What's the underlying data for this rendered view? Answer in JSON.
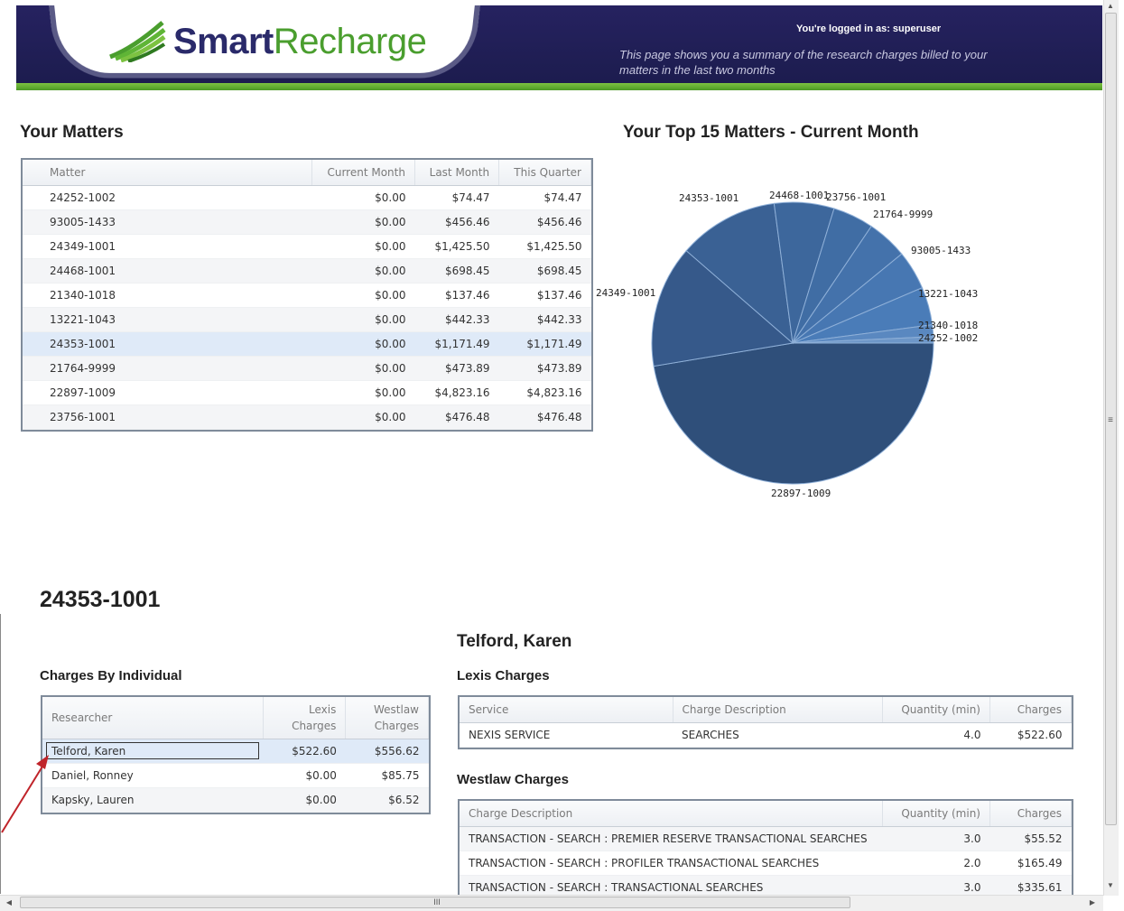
{
  "header": {
    "logo_smart": "Smart",
    "logo_recharge": "Recharge",
    "logged_in": "You're logged in as: superuser",
    "description": "This page shows you a summary of the research charges billed to your matters in the last two months"
  },
  "matters": {
    "title": "Your Matters",
    "columns": [
      "Matter",
      "Current Month",
      "Last Month",
      "This Quarter"
    ],
    "rows": [
      {
        "matter": "24252-1002",
        "current": "$0.00",
        "last": "$74.47",
        "quarter": "$74.47"
      },
      {
        "matter": "93005-1433",
        "current": "$0.00",
        "last": "$456.46",
        "quarter": "$456.46"
      },
      {
        "matter": "24349-1001",
        "current": "$0.00",
        "last": "$1,425.50",
        "quarter": "$1,425.50"
      },
      {
        "matter": "24468-1001",
        "current": "$0.00",
        "last": "$698.45",
        "quarter": "$698.45"
      },
      {
        "matter": "21340-1018",
        "current": "$0.00",
        "last": "$137.46",
        "quarter": "$137.46"
      },
      {
        "matter": "13221-1043",
        "current": "$0.00",
        "last": "$442.33",
        "quarter": "$442.33"
      },
      {
        "matter": "24353-1001",
        "current": "$0.00",
        "last": "$1,171.49",
        "quarter": "$1,171.49"
      },
      {
        "matter": "21764-9999",
        "current": "$0.00",
        "last": "$473.89",
        "quarter": "$473.89"
      },
      {
        "matter": "22897-1009",
        "current": "$0.00",
        "last": "$4,823.16",
        "quarter": "$4,823.16"
      },
      {
        "matter": "23756-1001",
        "current": "$0.00",
        "last": "$476.48",
        "quarter": "$476.48"
      }
    ]
  },
  "top15": {
    "title": "Your Top 15 Matters - Current Month",
    "slices": [
      {
        "label": "22897-1009",
        "value": 4823.16,
        "color": "#2f4f7a"
      },
      {
        "label": "24349-1001",
        "value": 1425.5,
        "color": "#36598a"
      },
      {
        "label": "24353-1001",
        "value": 1171.49,
        "color": "#3a6194"
      },
      {
        "label": "24468-1001",
        "value": 698.45,
        "color": "#3d679c"
      },
      {
        "label": "23756-1001",
        "value": 476.48,
        "color": "#406da4"
      },
      {
        "label": "21764-9999",
        "value": 473.89,
        "color": "#4472ab"
      },
      {
        "label": "93005-1433",
        "value": 456.46,
        "color": "#4777b2"
      },
      {
        "label": "13221-1043",
        "value": 442.33,
        "color": "#4a7cb8"
      },
      {
        "label": "21340-1018",
        "value": 137.46,
        "color": "#5a88c0"
      },
      {
        "label": "24252-1002",
        "value": 74.47,
        "color": "#6e97c8"
      }
    ]
  },
  "selected_matter": {
    "title": "24353-1001",
    "by_individual_title": "Charges By Individual",
    "columns": [
      "Researcher",
      "Lexis Charges",
      "Westlaw Charges"
    ],
    "rows": [
      {
        "name": "Telford, Karen",
        "lexis": "$522.60",
        "westlaw": "$556.62"
      },
      {
        "name": "Daniel, Ronney",
        "lexis": "$0.00",
        "westlaw": "$85.75"
      },
      {
        "name": "Kapsky, Lauren",
        "lexis": "$0.00",
        "westlaw": "$6.52"
      }
    ]
  },
  "researcher": {
    "name": "Telford, Karen",
    "lexis_title": "Lexis Charges",
    "lexis_columns": [
      "Service",
      "Charge Description",
      "Quantity (min)",
      "Charges"
    ],
    "lexis_rows": [
      {
        "service": "NEXIS SERVICE",
        "desc": "SEARCHES",
        "qty": "4.0",
        "charges": "$522.60"
      }
    ],
    "westlaw_title": "Westlaw Charges",
    "westlaw_columns": [
      "Charge Description",
      "Quantity (min)",
      "Charges"
    ],
    "westlaw_rows": [
      {
        "desc": "TRANSACTION - SEARCH : PREMIER RESERVE TRANSACTIONAL SEARCHES",
        "qty": "3.0",
        "charges": "$55.52"
      },
      {
        "desc": "TRANSACTION - SEARCH : PROFILER TRANSACTIONAL SEARCHES",
        "qty": "2.0",
        "charges": "$165.49"
      },
      {
        "desc": "TRANSACTION - SEARCH : TRANSACTIONAL SEARCHES",
        "qty": "3.0",
        "charges": "$335.61"
      }
    ]
  },
  "scrollbar": {
    "grip": "III"
  }
}
